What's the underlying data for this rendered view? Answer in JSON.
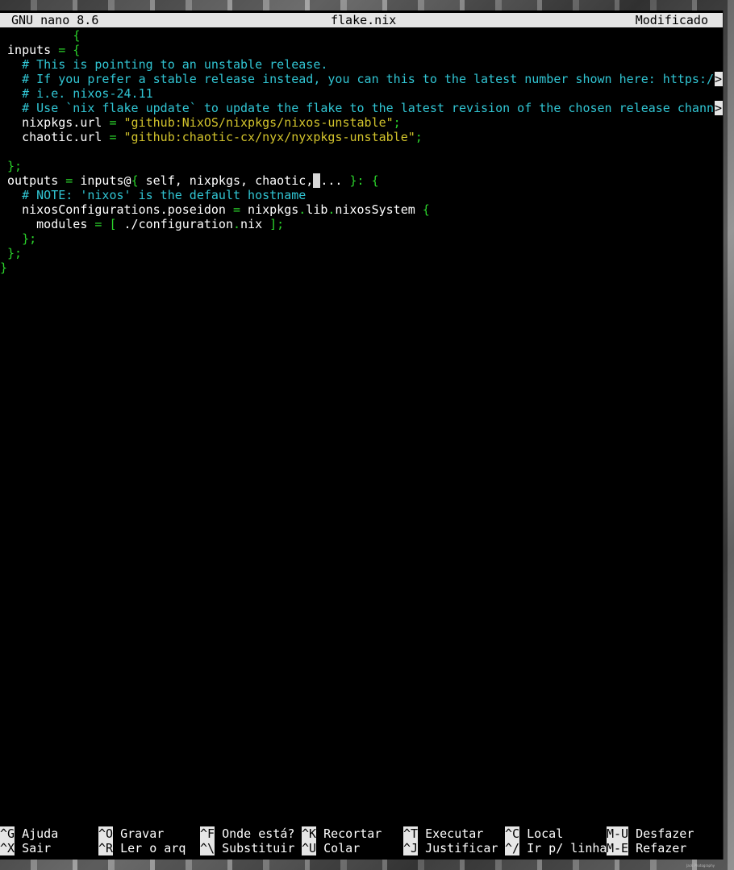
{
  "titlebar": {
    "app": "GNU nano 8.6",
    "filename": "flake.nix",
    "status": "Modificado"
  },
  "code_lines": [
    [
      {
        "t": "          ",
        "c": "c-white"
      },
      {
        "t": "{",
        "c": "c-green"
      }
    ],
    [
      {
        "t": " inputs ",
        "c": "c-white"
      },
      {
        "t": "= {",
        "c": "c-green"
      }
    ],
    [
      {
        "t": "   # This is pointing to an unstable release.",
        "c": "c-cyan"
      }
    ],
    [
      {
        "t": "   # If you prefer a stable release instead, you can this to the latest number shown here: https:/",
        "c": "c-cyan"
      }
    ],
    [
      {
        "t": "   # i.e. nixos-24.11",
        "c": "c-cyan"
      }
    ],
    [
      {
        "t": "   # Use `nix flake update` to update the flake to the latest revision of the chosen release chann",
        "c": "c-cyan"
      }
    ],
    [
      {
        "t": "   nixpkgs.url ",
        "c": "c-white"
      },
      {
        "t": "= ",
        "c": "c-green"
      },
      {
        "t": "\"github:NixOS/nixpkgs/nixos-unstable\"",
        "c": "c-yellow"
      },
      {
        "t": ";",
        "c": "c-green"
      }
    ],
    [
      {
        "t": "   chaotic.url ",
        "c": "c-white"
      },
      {
        "t": "= ",
        "c": "c-green"
      },
      {
        "t": "\"github:chaotic-cx/nyx/nyxpkgs-unstable\"",
        "c": "c-yellow"
      },
      {
        "t": ";",
        "c": "c-green"
      }
    ],
    [],
    [
      {
        "t": " };",
        "c": "c-green"
      }
    ],
    [
      {
        "t": " outputs ",
        "c": "c-white"
      },
      {
        "t": "= ",
        "c": "c-green"
      },
      {
        "t": "inputs@",
        "c": "c-white"
      },
      {
        "t": "{",
        "c": "c-green"
      },
      {
        "t": " self, nixpkgs, chaotic,",
        "c": "c-white"
      },
      {
        "t": " ",
        "c": "cursor"
      },
      {
        "t": "...",
        "c": "c-white"
      },
      {
        "t": " }: {",
        "c": "c-green"
      }
    ],
    [
      {
        "t": "   # NOTE: 'nixos' is the default hostname",
        "c": "c-cyan"
      }
    ],
    [
      {
        "t": "   nixosConfigurations.poseidon ",
        "c": "c-white"
      },
      {
        "t": "= ",
        "c": "c-green"
      },
      {
        "t": "nixpkgs",
        "c": "c-white"
      },
      {
        "t": ".",
        "c": "c-green"
      },
      {
        "t": "lib",
        "c": "c-white"
      },
      {
        "t": ".",
        "c": "c-green"
      },
      {
        "t": "nixosSystem ",
        "c": "c-white"
      },
      {
        "t": "{",
        "c": "c-green"
      }
    ],
    [
      {
        "t": "     modules ",
        "c": "c-white"
      },
      {
        "t": "= [ ",
        "c": "c-green"
      },
      {
        "t": "./configuration",
        "c": "c-white"
      },
      {
        "t": ".",
        "c": "c-green"
      },
      {
        "t": "nix ",
        "c": "c-white"
      },
      {
        "t": "];",
        "c": "c-green"
      }
    ],
    [
      {
        "t": "   };",
        "c": "c-green"
      }
    ],
    [
      {
        "t": " };",
        "c": "c-green"
      }
    ],
    [
      {
        "t": "}",
        "c": "c-green"
      }
    ]
  ],
  "overflow_marker": ">",
  "shortcuts_row1": [
    {
      "key": "^G",
      "label": "Ajuda"
    },
    {
      "key": "^O",
      "label": "Gravar"
    },
    {
      "key": "^F",
      "label": "Onde está?"
    },
    {
      "key": "^K",
      "label": "Recortar"
    },
    {
      "key": "^T",
      "label": "Executar"
    },
    {
      "key": "^C",
      "label": "Local"
    },
    {
      "key": "M-U",
      "label": "Desfazer"
    }
  ],
  "shortcuts_row2": [
    {
      "key": "^X",
      "label": "Sair"
    },
    {
      "key": "^R",
      "label": "Ler o arq"
    },
    {
      "key": "^\\",
      "label": "Substituir"
    },
    {
      "key": "^U",
      "label": "Colar"
    },
    {
      "key": "^J",
      "label": "Justificar"
    },
    {
      "key": "^/",
      "label": "Ir p/ linha"
    },
    {
      "key": "M-E",
      "label": "Refazer"
    }
  ],
  "wallpaper_credit": "Jack Photography"
}
